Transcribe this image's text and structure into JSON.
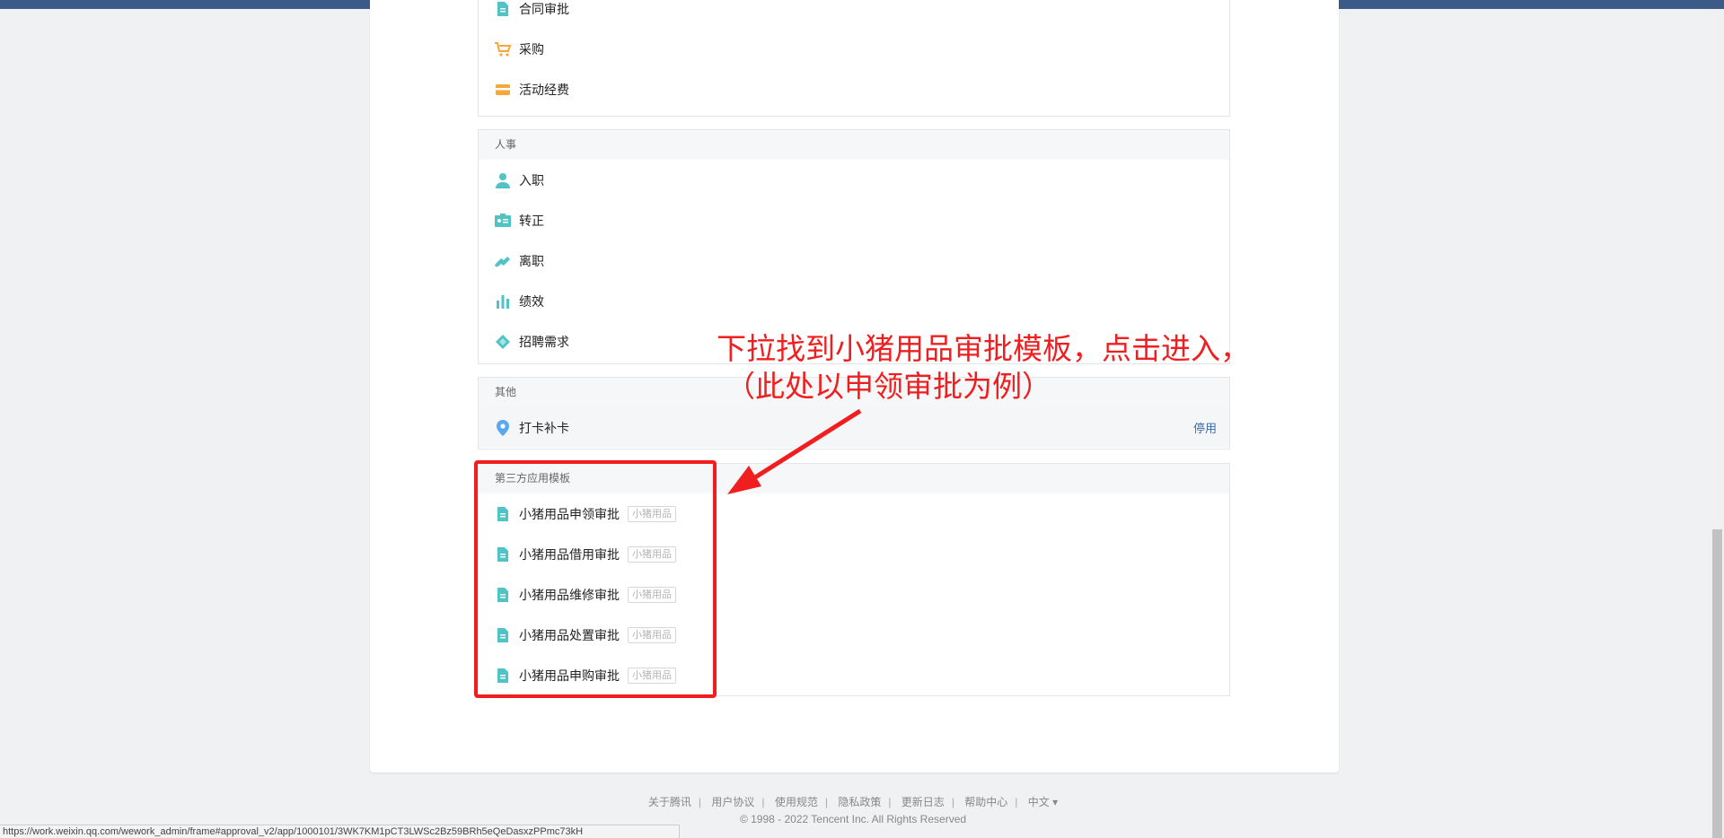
{
  "colors": {
    "accent": "#3b6aa8",
    "icon_teal": "#4fc3c6",
    "icon_orange": "#f7a63b",
    "annotation_red": "#f01e1e"
  },
  "finance_section": {
    "items": [
      {
        "label": "合同审批",
        "icon": "document-icon"
      },
      {
        "label": "采购",
        "icon": "cart-icon"
      },
      {
        "label": "活动经费",
        "icon": "wallet-icon"
      }
    ]
  },
  "hr_section": {
    "title": "人事",
    "items": [
      {
        "label": "入职",
        "icon": "person-icon"
      },
      {
        "label": "转正",
        "icon": "id-card-icon"
      },
      {
        "label": "离职",
        "icon": "handshake-icon"
      },
      {
        "label": "绩效",
        "icon": "bar-chart-icon"
      },
      {
        "label": "招聘需求",
        "icon": "tag-icon"
      }
    ]
  },
  "other_section": {
    "title": "其他",
    "items": [
      {
        "label": "打卡补卡",
        "icon": "location-pin-icon",
        "action": "停用"
      }
    ]
  },
  "third_party_section": {
    "title": "第三方应用模板",
    "items": [
      {
        "label": "小猪用品申领审批",
        "tag": "小猪用品",
        "icon": "document-icon"
      },
      {
        "label": "小猪用品借用审批",
        "tag": "小猪用品",
        "icon": "document-icon"
      },
      {
        "label": "小猪用品维修审批",
        "tag": "小猪用品",
        "icon": "document-icon"
      },
      {
        "label": "小猪用品处置审批",
        "tag": "小猪用品",
        "icon": "document-icon"
      },
      {
        "label": "小猪用品申购审批",
        "tag": "小猪用品",
        "icon": "document-icon"
      }
    ]
  },
  "annotation": {
    "line1": "下拉找到小猪用品审批模板，点击进入，",
    "line2": "（此处以申领审批为例）"
  },
  "footer": {
    "links": [
      "关于腾讯",
      "用户协议",
      "使用规范",
      "隐私政策",
      "更新日志",
      "帮助中心"
    ],
    "language": "中文 ▾",
    "copyright": "© 1998 - 2022 Tencent Inc. All Rights Reserved"
  },
  "status_bar": {
    "url": "https://work.weixin.qq.com/wework_admin/frame#approval_v2/app/1000101/3WK7KM1pCT3LWSc2Bz59BRh5eQeDasxzPPmc73kH"
  }
}
